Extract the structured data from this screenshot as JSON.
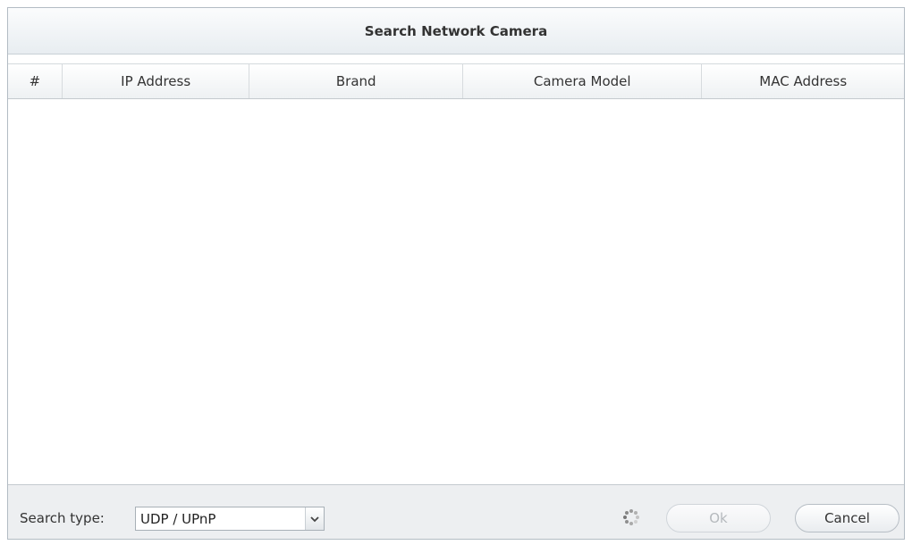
{
  "dialog": {
    "title": "Search Network Camera"
  },
  "table": {
    "columns": [
      "#",
      "IP Address",
      "Brand",
      "Camera Model",
      "MAC Address"
    ],
    "rows": []
  },
  "footer": {
    "search_type_label": "Search type:",
    "search_type_value": "UDP / UPnP",
    "ok_label": "Ok",
    "cancel_label": "Cancel",
    "ok_enabled": false
  },
  "icons": {
    "dropdown": "chevron-down-icon",
    "loading": "loading-spinner-icon"
  },
  "colors": {
    "title_bg": "#e8edf1",
    "footer_bg": "#edeff1",
    "disabled_text": "#b5b9bd"
  }
}
